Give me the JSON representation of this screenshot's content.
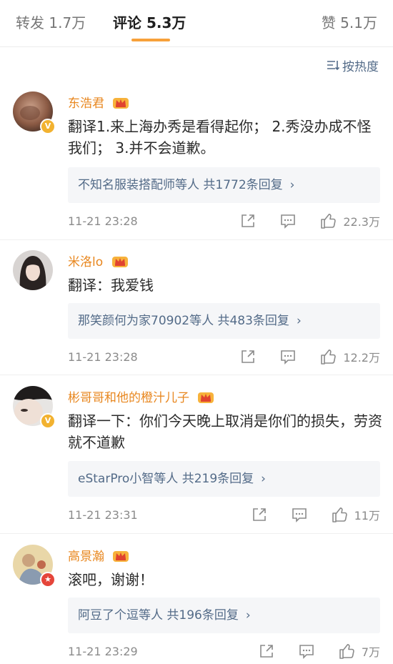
{
  "tabs": {
    "repost": "转发 1.7万",
    "comment": "评论 5.3万",
    "like": "赞 5.1万"
  },
  "sort": {
    "label": "按热度",
    "icon": "sort-lines-icon"
  },
  "colors": {
    "accent": "#f7a13a",
    "username": "#e8871f",
    "link": "#536b88",
    "meta": "#8b8b8b"
  },
  "comments": [
    {
      "username": "东浩君",
      "badge": "v",
      "text": "翻译1.来上海办秀是看得起你； 2.秀没办成不怪我们； 3.并不会道歉。",
      "replies": "不知名服装搭配师等人  共1772条回复",
      "time": "11-21 23:28",
      "likes": "22.3万"
    },
    {
      "username": "米洛lo",
      "badge": "",
      "text": "翻译：我爱钱",
      "replies": "那笑颜何为家70902等人  共483条回复",
      "time": "11-21 23:28",
      "likes": "12.2万"
    },
    {
      "username": "彬哥哥和他的橙汁儿子",
      "badge": "v",
      "text": "翻译一下：你们今天晚上取消是你们的损失，劳资就不道歉",
      "replies": "eStarPro小智等人  共219条回复",
      "time": "11-21 23:31",
      "likes": "11万"
    },
    {
      "username": "高景瀚",
      "badge": "r",
      "text": "滚吧，谢谢！",
      "replies": "阿豆了个逗等人  共196条回复",
      "time": "11-21 23:29",
      "likes": "7万"
    }
  ]
}
